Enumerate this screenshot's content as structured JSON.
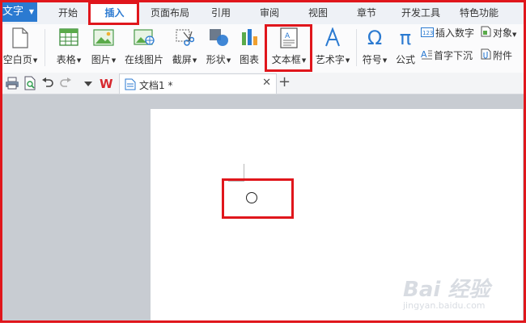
{
  "app": {
    "name": "文字"
  },
  "menu_tabs": [
    "开始",
    "插入",
    "页面布局",
    "引用",
    "审阅",
    "视图",
    "章节",
    "开发工具",
    "特色功能"
  ],
  "active_tab": "插入",
  "ribbon": {
    "blank_page": "空白页",
    "table": "表格",
    "picture": "图片",
    "online_picture": "在线图片",
    "screenshot": "截屏",
    "shapes": "形状",
    "chart": "图表",
    "textbox": "文本框",
    "wordart": "艺术字",
    "symbol": "符号",
    "formula": "公式",
    "insert_number": "插入数字",
    "object": "对象",
    "dropcap": "首字下沉",
    "attachment": "附件"
  },
  "document_tab": {
    "title": "文档1 *"
  },
  "watermark": {
    "brand": "Bai 经验",
    "url": "jingyan.baidu.com"
  },
  "colors": {
    "accent": "#2b7ad1",
    "highlight": "#e0161c",
    "workspace": "#c8ccd2"
  }
}
